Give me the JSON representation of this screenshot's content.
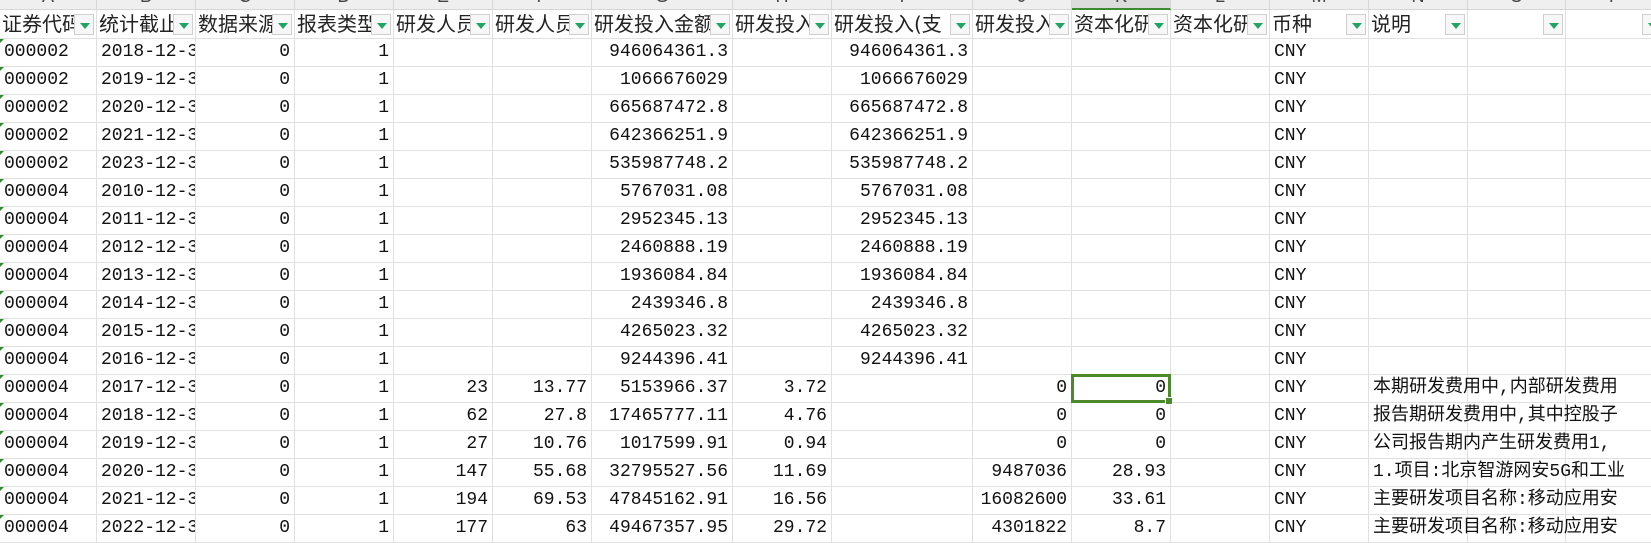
{
  "columns": [
    "A",
    "B",
    "C",
    "D",
    "E",
    "F",
    "G",
    "H",
    "I",
    "J",
    "K",
    "L",
    "M",
    "N",
    "O",
    "P"
  ],
  "active_column": "K",
  "headers": [
    "证券代码",
    "统计截止",
    "数据来源",
    "报表类型",
    "研发人员",
    "研发人员",
    "研发投入金额",
    "研发投入",
    "研发投入(支",
    "研发投入",
    "资本化研",
    "资本化研",
    "币种",
    "说明",
    "",
    ""
  ],
  "rows": [
    [
      "000002",
      "2018-12-3",
      "0",
      "1",
      "",
      "",
      "946064361.3",
      "",
      "946064361.3",
      "",
      "",
      "",
      "CNY",
      "",
      "",
      ""
    ],
    [
      "000002",
      "2019-12-3",
      "0",
      "1",
      "",
      "",
      "1066676029",
      "",
      "1066676029",
      "",
      "",
      "",
      "CNY",
      "",
      "",
      ""
    ],
    [
      "000002",
      "2020-12-3",
      "0",
      "1",
      "",
      "",
      "665687472.8",
      "",
      "665687472.8",
      "",
      "",
      "",
      "CNY",
      "",
      "",
      ""
    ],
    [
      "000002",
      "2021-12-3",
      "0",
      "1",
      "",
      "",
      "642366251.9",
      "",
      "642366251.9",
      "",
      "",
      "",
      "CNY",
      "",
      "",
      ""
    ],
    [
      "000002",
      "2023-12-3",
      "0",
      "1",
      "",
      "",
      "535987748.2",
      "",
      "535987748.2",
      "",
      "",
      "",
      "CNY",
      "",
      "",
      ""
    ],
    [
      "000004",
      "2010-12-3",
      "0",
      "1",
      "",
      "",
      "5767031.08",
      "",
      "5767031.08",
      "",
      "",
      "",
      "CNY",
      "",
      "",
      ""
    ],
    [
      "000004",
      "2011-12-3",
      "0",
      "1",
      "",
      "",
      "2952345.13",
      "",
      "2952345.13",
      "",
      "",
      "",
      "CNY",
      "",
      "",
      ""
    ],
    [
      "000004",
      "2012-12-3",
      "0",
      "1",
      "",
      "",
      "2460888.19",
      "",
      "2460888.19",
      "",
      "",
      "",
      "CNY",
      "",
      "",
      ""
    ],
    [
      "000004",
      "2013-12-3",
      "0",
      "1",
      "",
      "",
      "1936084.84",
      "",
      "1936084.84",
      "",
      "",
      "",
      "CNY",
      "",
      "",
      ""
    ],
    [
      "000004",
      "2014-12-3",
      "0",
      "1",
      "",
      "",
      "2439346.8",
      "",
      "2439346.8",
      "",
      "",
      "",
      "CNY",
      "",
      "",
      ""
    ],
    [
      "000004",
      "2015-12-3",
      "0",
      "1",
      "",
      "",
      "4265023.32",
      "",
      "4265023.32",
      "",
      "",
      "",
      "CNY",
      "",
      "",
      ""
    ],
    [
      "000004",
      "2016-12-3",
      "0",
      "1",
      "",
      "",
      "9244396.41",
      "",
      "9244396.41",
      "",
      "",
      "",
      "CNY",
      "",
      "",
      ""
    ],
    [
      "000004",
      "2017-12-3",
      "0",
      "1",
      "23",
      "13.77",
      "5153966.37",
      "3.72",
      "",
      "0",
      "0",
      "",
      "CNY",
      "本期研发费用中,内部研发费用",
      "",
      ""
    ],
    [
      "000004",
      "2018-12-3",
      "0",
      "1",
      "62",
      "27.8",
      "17465777.11",
      "4.76",
      "",
      "0",
      "0",
      "",
      "CNY",
      "报告期研发费用中,其中控股子",
      "",
      ""
    ],
    [
      "000004",
      "2019-12-3",
      "0",
      "1",
      "27",
      "10.76",
      "1017599.91",
      "0.94",
      "",
      "0",
      "0",
      "",
      "CNY",
      "公司报告期内产生研发费用1,",
      "",
      ""
    ],
    [
      "000004",
      "2020-12-3",
      "0",
      "1",
      "147",
      "55.68",
      "32795527.56",
      "11.69",
      "",
      "9487036",
      "28.93",
      "",
      "CNY",
      "1.项目:北京智游网安5G和工业",
      "",
      ""
    ],
    [
      "000004",
      "2021-12-3",
      "0",
      "1",
      "194",
      "69.53",
      "47845162.91",
      "16.56",
      "",
      "16082600",
      "33.61",
      "",
      "CNY",
      "主要研发项目名称:移动应用安",
      "",
      ""
    ],
    [
      "000004",
      "2022-12-3",
      "0",
      "1",
      "177",
      "63",
      "49467357.95",
      "29.72",
      "",
      "4301822",
      "8.7",
      "",
      "CNY",
      "主要研发项目名称:移动应用安",
      "",
      ""
    ]
  ],
  "selected_cell": {
    "column": "K",
    "row": 13,
    "value": "0"
  },
  "colors": {
    "accent": "#4a8a2a",
    "filter_arrow": "#21a366",
    "gridline": "#e0e0e0"
  }
}
